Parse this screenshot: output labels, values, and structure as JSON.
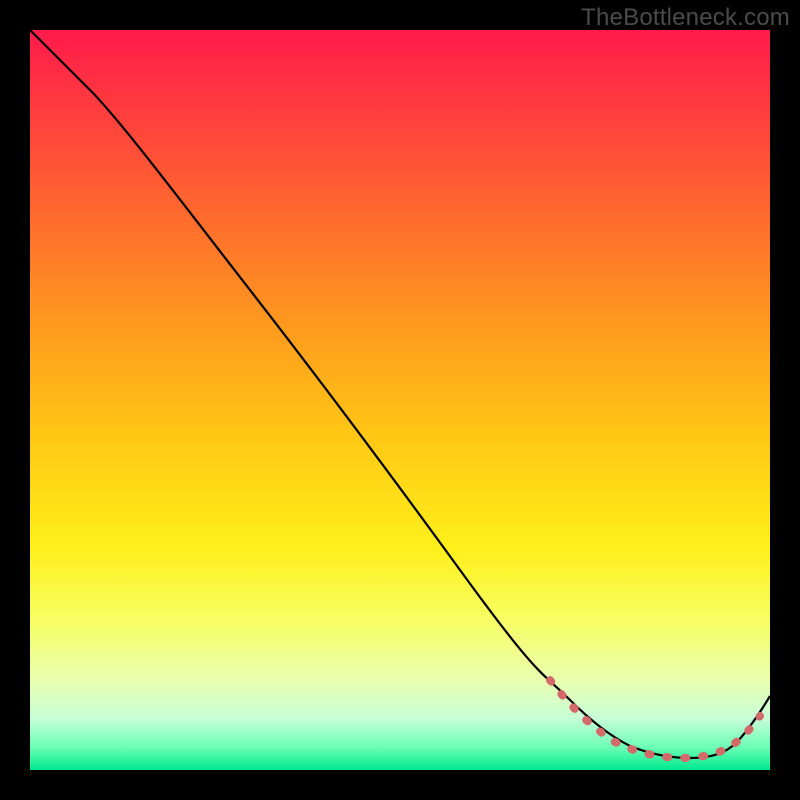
{
  "watermark": "TheBottleneck.com",
  "chart_data": {
    "type": "line",
    "title": "",
    "xlabel": "",
    "ylabel": "",
    "xlim": [
      0,
      100
    ],
    "ylim": [
      0,
      100
    ],
    "grid": false,
    "series": [
      {
        "name": "curve",
        "x": [
          0,
          5,
          10,
          15,
          20,
          25,
          30,
          35,
          40,
          45,
          50,
          55,
          60,
          65,
          70,
          73,
          76,
          80,
          84,
          88,
          92,
          95,
          98,
          100
        ],
        "values": [
          100,
          97,
          93,
          88,
          81,
          74,
          67,
          60,
          53,
          46,
          39,
          32,
          25,
          18,
          12,
          8,
          5,
          3,
          2,
          2,
          2,
          3,
          6,
          10
        ]
      }
    ],
    "highlighted_region": {
      "description": "dotted segment near the trough",
      "x_start": 70,
      "x_end": 98
    },
    "background": "vertical-heatmap-gradient",
    "colors": {
      "top": "#ff1b4a",
      "mid": "#fff01a",
      "bottom": "#00e98f",
      "frame": "#000000",
      "dots": "#d36a6a"
    }
  }
}
